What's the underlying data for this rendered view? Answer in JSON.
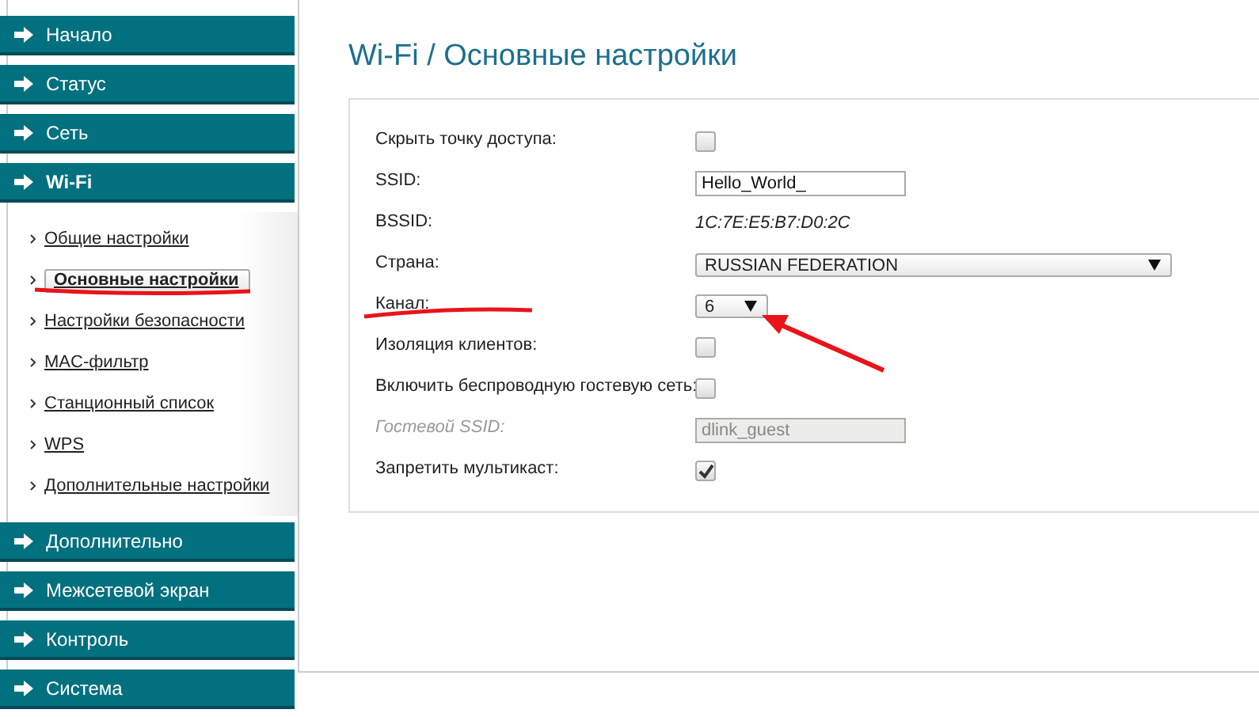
{
  "sidebar": {
    "items": [
      {
        "label": "Начало",
        "expanded": false
      },
      {
        "label": "Статус",
        "expanded": false
      },
      {
        "label": "Сеть",
        "expanded": false
      },
      {
        "label": "Wi-Fi",
        "expanded": true,
        "children": [
          {
            "label": "Общие настройки",
            "selected": false
          },
          {
            "label": "Основные настройки",
            "selected": true
          },
          {
            "label": "Настройки безопасности",
            "selected": false
          },
          {
            "label": "MAC-фильтр",
            "selected": false
          },
          {
            "label": "Станционный список",
            "selected": false
          },
          {
            "label": "WPS",
            "selected": false
          },
          {
            "label": "Дополнительные настройки",
            "selected": false
          }
        ]
      },
      {
        "label": "Дополнительно",
        "expanded": false
      },
      {
        "label": "Межсетевой экран",
        "expanded": false
      },
      {
        "label": "Контроль",
        "expanded": false
      },
      {
        "label": "Система",
        "expanded": false
      }
    ]
  },
  "page_title": "Wi-Fi / Основные настройки",
  "form": [
    {
      "kind": "checkbox",
      "label": "Скрыть точку доступа:",
      "checked": false
    },
    {
      "kind": "text",
      "label": "SSID:",
      "value": "Hello_World_",
      "disabled": false
    },
    {
      "kind": "static",
      "label": "BSSID:",
      "value": "1C:7E:E5:B7:D0:2C"
    },
    {
      "kind": "select",
      "label": "Страна:",
      "value": "RUSSIAN FEDERATION"
    },
    {
      "kind": "select-small",
      "label": "Канал:",
      "value": "6"
    },
    {
      "kind": "checkbox",
      "label": "Изоляция клиентов:",
      "checked": false
    },
    {
      "kind": "checkbox",
      "label": "Включить беспроводную гостевую сеть:",
      "checked": false
    },
    {
      "kind": "text",
      "label": "Гостевой SSID:",
      "value": "dlink_guest",
      "disabled": true
    },
    {
      "kind": "checkbox",
      "label": "Запретить мультикаст:",
      "checked": true
    }
  ]
}
